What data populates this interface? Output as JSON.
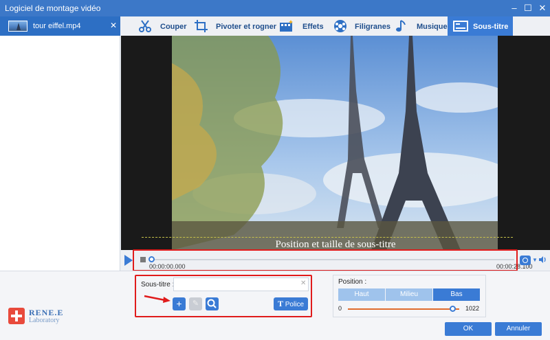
{
  "window": {
    "title": "Logiciel de montage vidéo",
    "buttons": [
      "–",
      "☐",
      "✕"
    ]
  },
  "file_list": {
    "items": [
      {
        "name": "tour eiffel.mp4",
        "close": "✕"
      }
    ]
  },
  "tabs": [
    {
      "label": "Couper",
      "icon": "cut-icon"
    },
    {
      "label": "Pivoter et rogner",
      "icon": "crop-icon"
    },
    {
      "label": "Effets",
      "icon": "effects-icon"
    },
    {
      "label": "Filigranes",
      "icon": "watermark-icon"
    },
    {
      "label": "Musique",
      "icon": "music-icon"
    },
    {
      "label": "Sous-titre",
      "icon": "subtitle-icon",
      "active": true
    }
  ],
  "preview": {
    "subtitle_overlay": "Position et taille de sous-titre"
  },
  "timeline": {
    "start_time": "00:00:00.000",
    "end_time": "00:00:28.100",
    "progress": 0
  },
  "subtitle_panel": {
    "label": "Sous-titre :",
    "input_value": "",
    "clear": "✕",
    "add": "+",
    "edit": "✎",
    "search": "⌕",
    "font_button": "Police",
    "font_icon": "T"
  },
  "position_panel": {
    "label": "Position :",
    "options": [
      "Haut",
      "Milieu",
      "Bas"
    ],
    "selected": "Bas",
    "slider_min": "0",
    "slider_max": "1022",
    "slider_fraction": 0.91
  },
  "logo": {
    "line1": "RENE.E",
    "line2": "Laboratory"
  },
  "actions": {
    "ok": "OK",
    "cancel": "Annuler"
  },
  "colors": {
    "accent": "#3a7bd5",
    "titlebar": "#3c78c8",
    "highlight": "#e01b1b"
  }
}
